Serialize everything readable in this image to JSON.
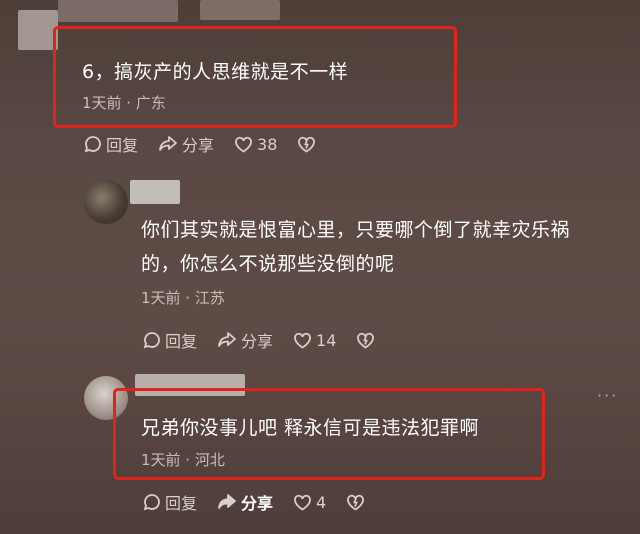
{
  "comments": [
    {
      "text": "6，搞灰产的人思维就是不一样",
      "meta": "1天前 · 广东",
      "reply_label": "回复",
      "share_label": "分享",
      "like_count": "38"
    },
    {
      "text_line1": "你们其实就是恨富心里，只要哪个倒了就幸灾乐祸",
      "text_line2": "的，你怎么不说那些没倒的呢",
      "meta": "1天前 · 江苏",
      "reply_label": "回复",
      "share_label": "分享",
      "like_count": "14"
    },
    {
      "text": "兄弟你没事儿吧 释永信可是违法犯罪啊",
      "meta": "1天前 · 河北",
      "reply_label": "回复",
      "share_label": "分享",
      "like_count": "4"
    }
  ],
  "more_label": "···",
  "colors": {
    "highlight": "#e2231a",
    "background": "#5a4944",
    "meta_text": "#c9bcb8"
  },
  "icons": [
    "comment-bubble-icon",
    "share-arrow-icon",
    "heart-icon",
    "dislike-heart-icon",
    "more-icon"
  ]
}
